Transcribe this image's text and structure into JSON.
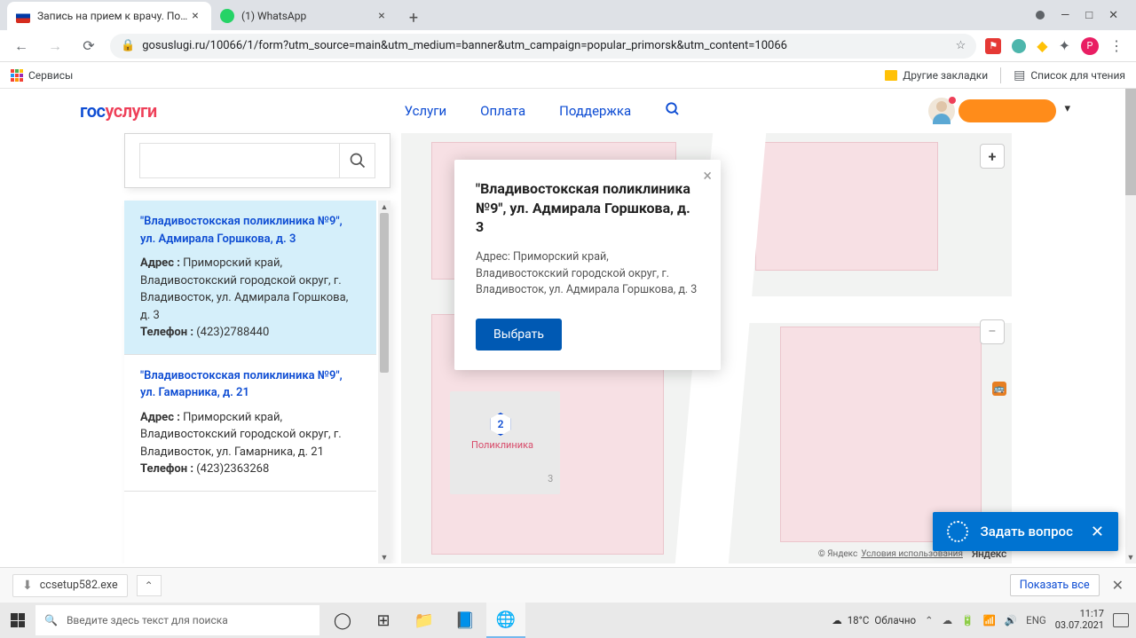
{
  "browser": {
    "tabs": [
      {
        "title": "Запись на прием к врачу. Порта",
        "favicon": "ru"
      },
      {
        "title": "(1) WhatsApp",
        "favicon": "wa"
      }
    ],
    "url": "gosuslugi.ru/10066/1/form?utm_source=main&utm_medium=banner&utm_campaign=popular_primorsk&utm_content=10066",
    "bookmarks": {
      "services": "Сервисы",
      "other": "Другие закладки",
      "reading_list": "Список для чтения"
    }
  },
  "header": {
    "logo_part1": "гос",
    "logo_part2": "услуги",
    "nav": {
      "services": "Услуги",
      "payment": "Оплата",
      "support": "Поддержка"
    }
  },
  "search": {
    "placeholder": ""
  },
  "clinics": [
    {
      "title": "\"Владивостокская поликлиника №9\", ул. Адмирала Горшкова, д. 3",
      "address_label": "Адрес :",
      "address": "Приморский край, Владивостокский городской округ, г. Владивосток, ул. Адмирала Горшкова, д. 3",
      "phone_label": "Телефон :",
      "phone": "(423)2788440",
      "selected": true
    },
    {
      "title": "\"Владивостокская поликлиника №9\", ул. Гамарника, д. 21",
      "address_label": "Адрес :",
      "address": "Приморский край, Владивостокский городской округ, г. Владивосток, ул. Гамарника, д. 21",
      "phone_label": "Телефон :",
      "phone": "(423)2363268",
      "selected": false
    }
  ],
  "popup": {
    "title": "\"Владивостокская поликлиника №9\", ул. Адмирала Горшкова, д. 3",
    "address": "Адрес: Приморский край, Владивостокский городской округ, г. Владивосток, ул. Адмирала Горшкова, д. 3",
    "select_btn": "Выбрать"
  },
  "map": {
    "marker_count": "2",
    "marker_label": "Поликлиника",
    "building_num": "3",
    "attribution_prefix": "© Яндекс",
    "attribution_link": "Условия использования",
    "yandex_logo": "Яндекс"
  },
  "ask": {
    "label": "Задать вопрос"
  },
  "download": {
    "filename": "ccsetup582.exe",
    "show_all": "Показать все"
  },
  "taskbar": {
    "search_placeholder": "Введите здесь текст для поиска",
    "weather_temp": "18°C",
    "weather_desc": "Облачно",
    "lang": "ENG",
    "time": "11:17",
    "date": "03.07.2021"
  }
}
